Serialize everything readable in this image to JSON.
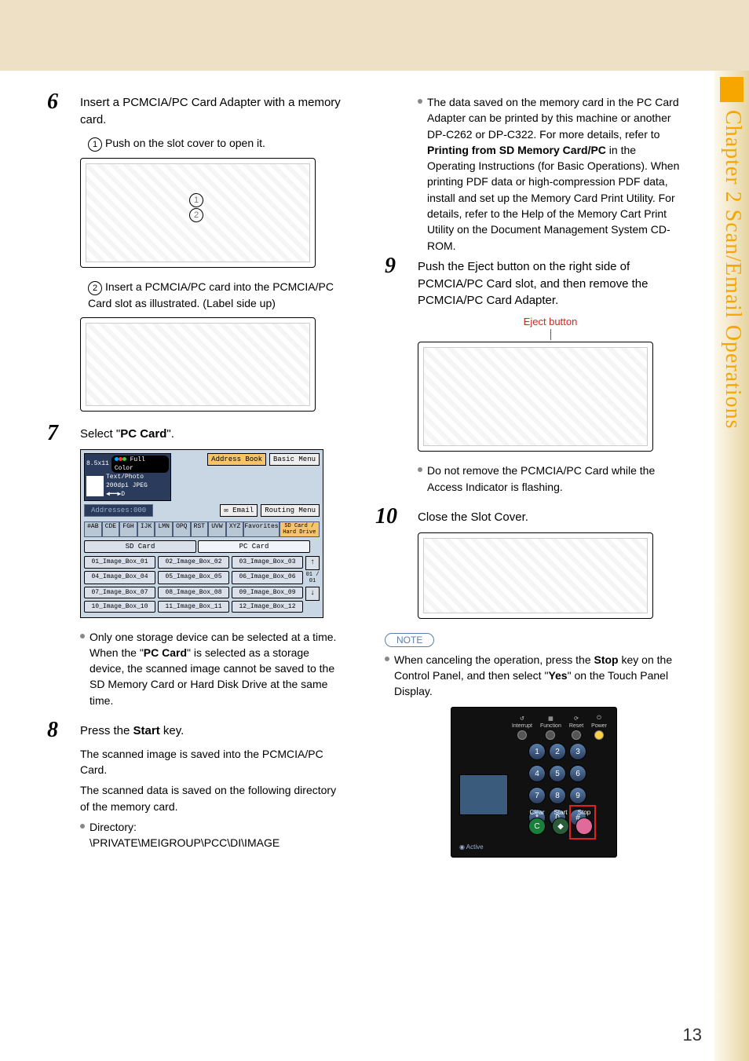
{
  "sideLabel": "Chapter 2    Scan/Email Operations",
  "pageNumber": "13",
  "left": {
    "step6": {
      "num": "6",
      "title_a": "Insert a PCMCIA/PC Card Adapter with a memory card.",
      "sub1_num": "1",
      "sub1": "Push on the slot cover to open it.",
      "sub2_num": "2",
      "sub2": "Insert a PCMCIA/PC card into the PCMCIA/PC Card slot as illustrated. (Label side up)"
    },
    "step7": {
      "num": "7",
      "title_pre": "Select \"",
      "title_bold": "PC Card",
      "title_post": "\".",
      "bullet_a": "Only one storage device can be selected at a time. When the \"",
      "bullet_bold": "PC Card",
      "bullet_b": "\" is selected as a storage device, the scanned image cannot be saved to the SD Memory Card or Hard Disk Drive at the same time."
    },
    "step8": {
      "num": "8",
      "title_pre": "Press the ",
      "title_bold": "Start",
      "title_post": " key.",
      "line1": "The scanned image is saved into the PCMCIA/PC Card.",
      "line2": "The scanned data is saved on the following directory of the memory card.",
      "dir_label": "Directory:",
      "dir_value": "\\PRIVATE\\MEIGROUP\\PCC\\DI\\IMAGE"
    },
    "uiPanel": {
      "paperSize": "8.5x11",
      "fullColor": "Full Color",
      "mode": "Text/Photo",
      "dpi": "200dpi JPEG",
      "addressBook": "Address Book",
      "basicMenu": "Basic Menu",
      "addresses": "Addresses:000",
      "email": "Email",
      "routing": "Routing Menu",
      "alphaTabs": [
        "#AB",
        "CDE",
        "FGH",
        "IJK",
        "LMN",
        "OPQ",
        "RST",
        "UVW",
        "XYZ"
      ],
      "favorites": "Favorites",
      "sdHD": "SD Card / Hard Drive",
      "sdCard": "SD Card",
      "pcCard": "PC Card",
      "boxes": [
        "01_Image_Box_01",
        "02_Image_Box_02",
        "03_Image_Box_03",
        "04_Image_Box_04",
        "05_Image_Box_05",
        "06_Image_Box_06",
        "07_Image_Box_07",
        "08_Image_Box_08",
        "09_Image_Box_09",
        "10_Image_Box_10",
        "11_Image_Box_11",
        "12_Image_Box_12"
      ],
      "pageIndicator": "01 / 01"
    }
  },
  "right": {
    "topBullet_a": "The data saved on the memory card in the PC Card Adapter can be printed by this machine or another DP-C262 or DP-C322. For more details, refer to ",
    "topBullet_bold": "Printing from SD Memory Card/PC",
    "topBullet_b": " in the Operating Instructions (for Basic Operations). When printing PDF data or high-compression PDF data, install and set up the Memory Card Print Utility. For details, refer to the Help of the Memory Cart Print Utility on the Document Management System CD-ROM.",
    "step9": {
      "num": "9",
      "title": "Push the Eject button on the right side of PCMCIA/PC Card slot, and then remove the PCMCIA/PC Card Adapter.",
      "ejectLabel": "Eject button",
      "bullet": "Do not remove the PCMCIA/PC Card while the Access Indicator is flashing."
    },
    "step10": {
      "num": "10",
      "title": "Close the Slot Cover."
    },
    "note": {
      "badge": "NOTE",
      "text_a": "When canceling the operation, press the ",
      "text_bold1": "Stop",
      "text_b": " key on the Control Panel, and then select \"",
      "text_bold2": "Yes",
      "text_c": "\" on the Touch Panel Display."
    },
    "controlPanel": {
      "topIcons": [
        "Interrupt",
        "Function",
        "Reset",
        "Power"
      ],
      "keys": [
        "1",
        "2",
        "3",
        "4",
        "5",
        "6",
        "7",
        "8",
        "9",
        "*",
        "0",
        "#"
      ],
      "clear": "Clear",
      "start": "Start",
      "stop": "Stop",
      "active": "Active"
    }
  }
}
